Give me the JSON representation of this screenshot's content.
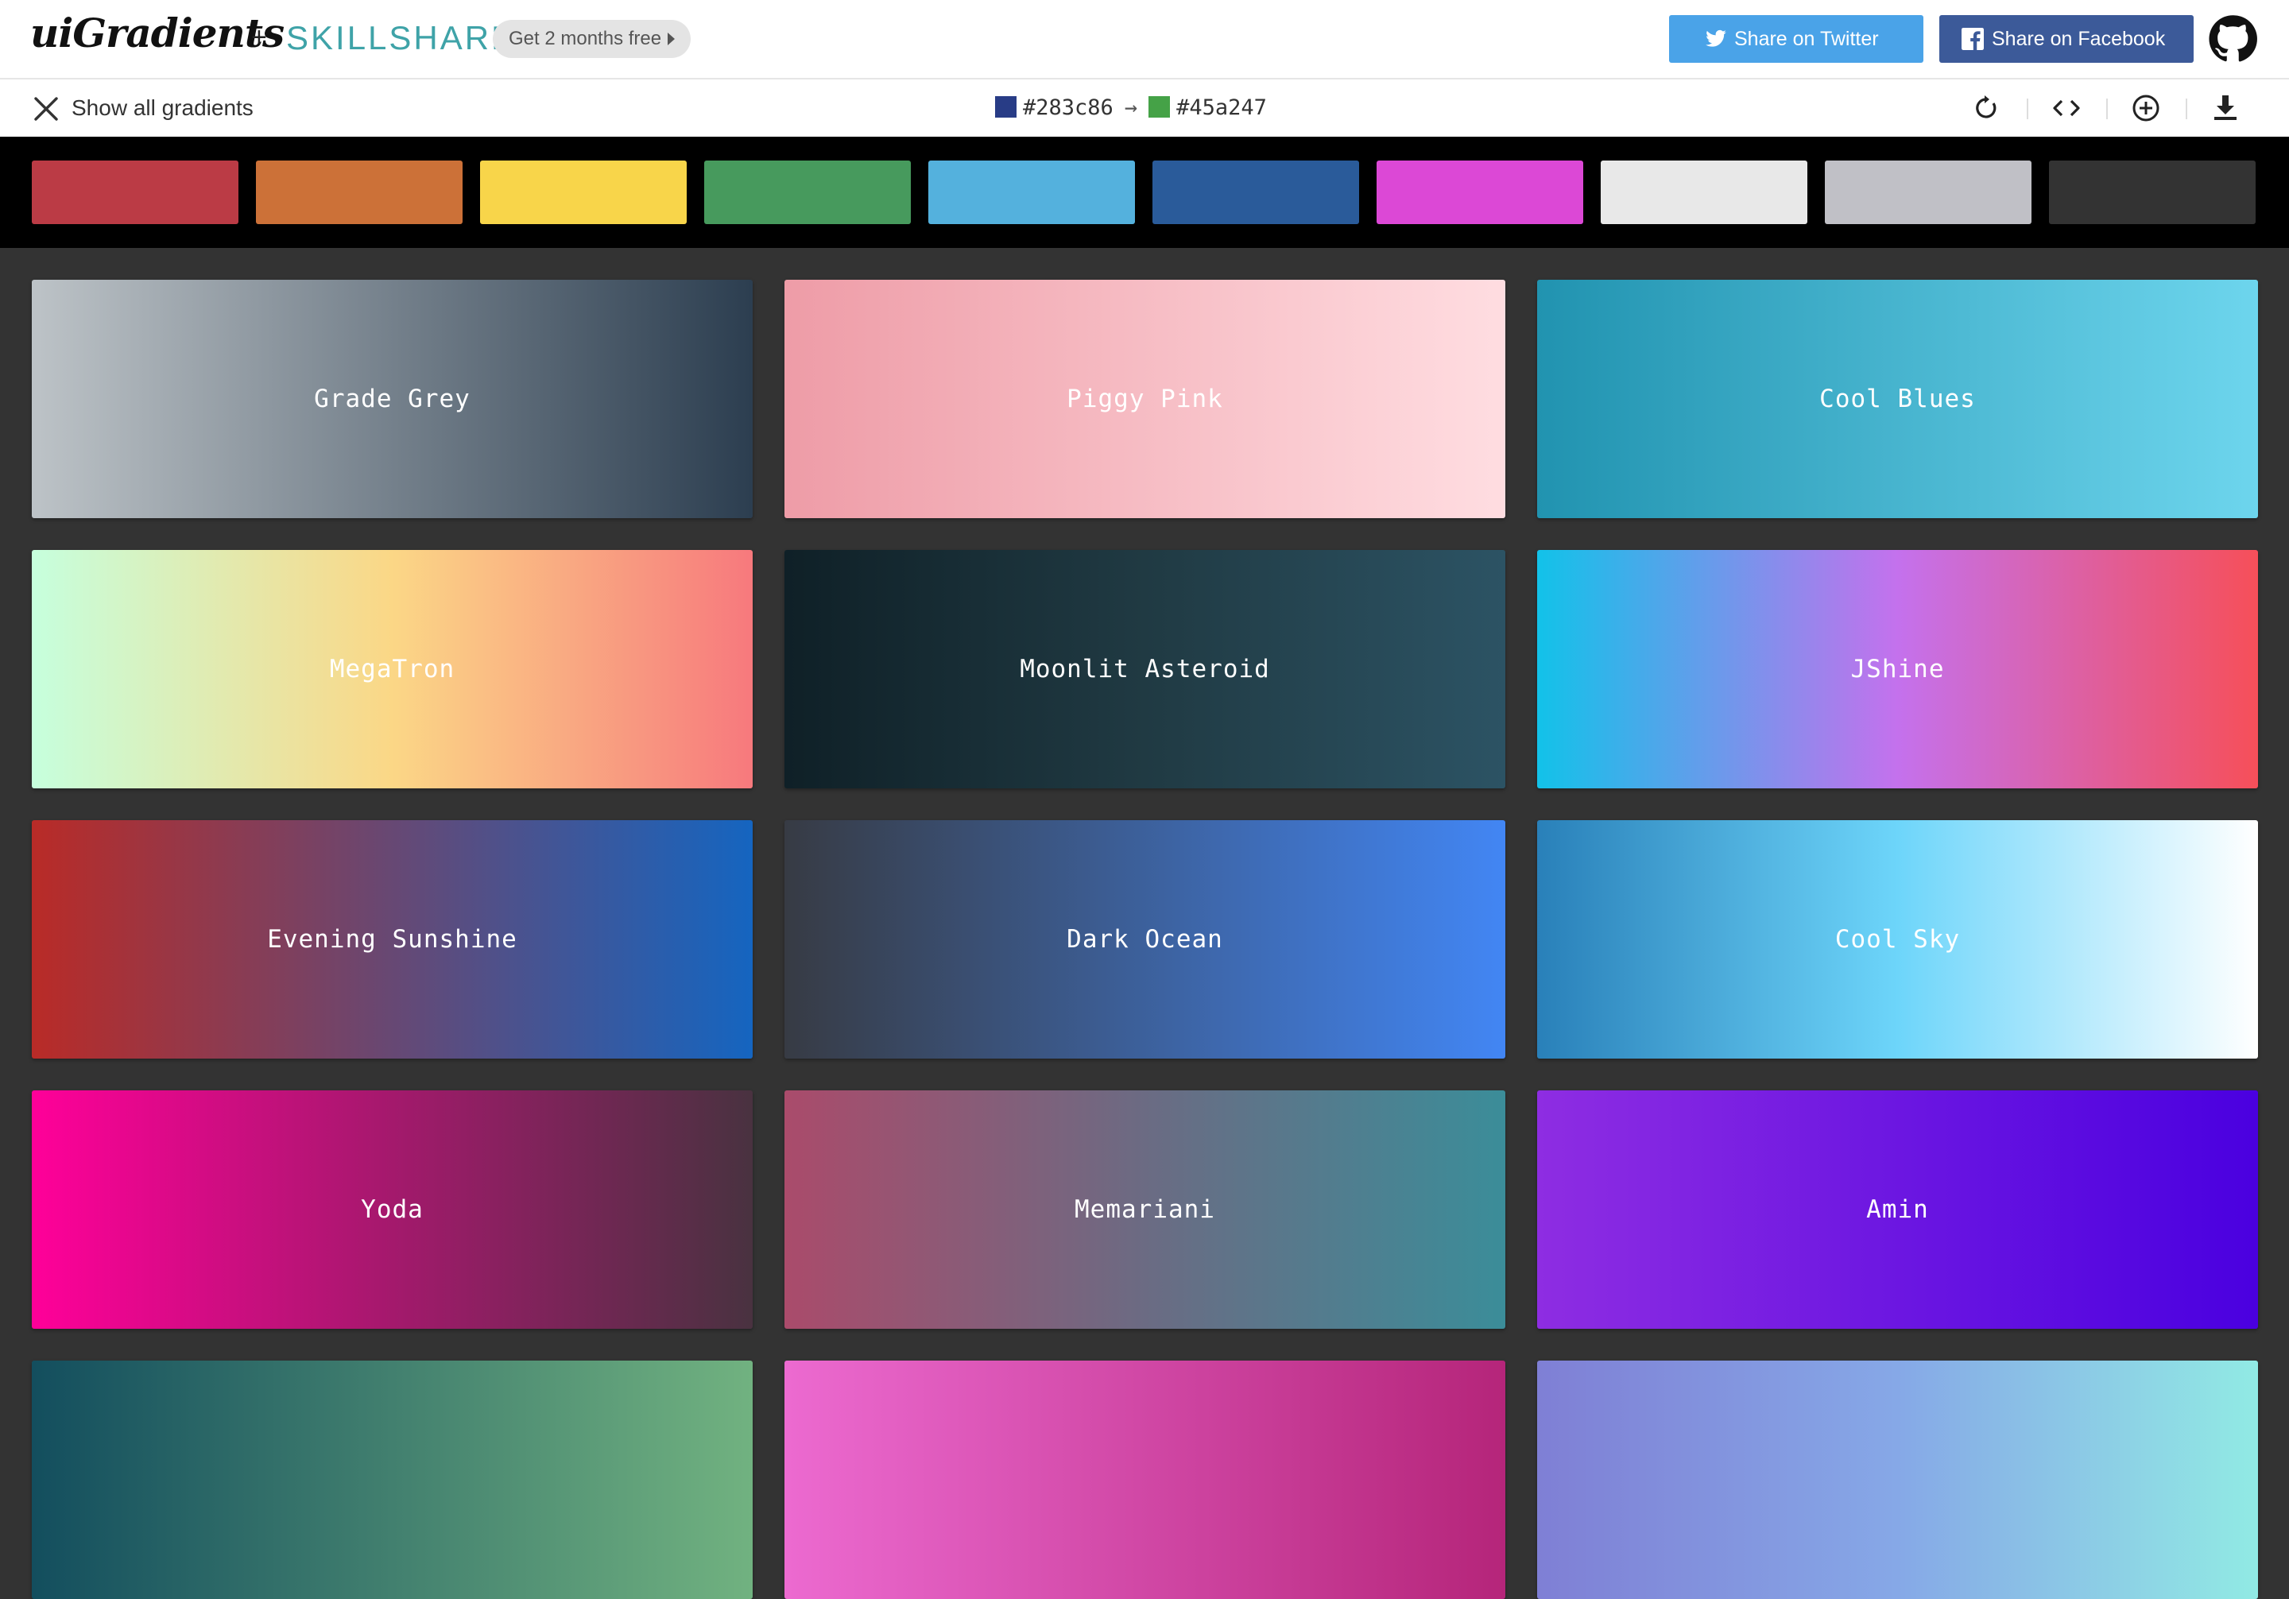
{
  "header": {
    "logo": "uiGradients",
    "plus": "+",
    "partner": "SKILLSHARE",
    "promo": "Get 2 months free",
    "share_twitter": "Share on Twitter",
    "share_facebook": "Share on Facebook"
  },
  "toolbar": {
    "show_all": "Show all gradients",
    "from_color": "#283c86",
    "to_color": "#45a247",
    "arrow": "→"
  },
  "filters": [
    {
      "color": "#bb3b45"
    },
    {
      "color": "#cc7138"
    },
    {
      "color": "#f8d54a"
    },
    {
      "color": "#479a5d"
    },
    {
      "color": "#54b1dd"
    },
    {
      "color": "#2a5b9a"
    },
    {
      "color": "#dc48d6"
    },
    {
      "color": "#e8e8e8"
    },
    {
      "color": "#c0c0c6"
    },
    {
      "color": "#333333"
    }
  ],
  "gradients": [
    {
      "name": "Grade Grey",
      "from": "#bdc3c7",
      "to": "#2c3e50"
    },
    {
      "name": "Piggy Pink",
      "from": "#ee9ca7",
      "to": "#ffdde1"
    },
    {
      "name": "Cool Blues",
      "from": "#2193b0",
      "to": "#6dd5ed"
    },
    {
      "name": "MegaTron",
      "from": "#c6ffdd",
      "via": "#fbd786",
      "to": "#f7797d"
    },
    {
      "name": "Moonlit Asteroid",
      "from": "#0f2027",
      "via": "#203a43",
      "to": "#2c5364"
    },
    {
      "name": "JShine",
      "from": "#12c2e9",
      "via": "#c471ed",
      "to": "#f64f59"
    },
    {
      "name": "Evening Sunshine",
      "from": "#b92b27",
      "to": "#1565c0"
    },
    {
      "name": "Dark Ocean",
      "from": "#373b44",
      "to": "#4286f4"
    },
    {
      "name": "Cool Sky",
      "from": "#2980b9",
      "via": "#6dd5fa",
      "to": "#ffffff"
    },
    {
      "name": "Yoda",
      "from": "#ff0099",
      "to": "#493240"
    },
    {
      "name": "Memariani",
      "from": "#aa4b6b",
      "via": "#6b6b83",
      "to": "#3b8d99"
    },
    {
      "name": "Amin",
      "from": "#8e2de2",
      "to": "#4a00e0"
    },
    {
      "name": "",
      "from": "#134e5e",
      "to": "#71b280"
    },
    {
      "name": "",
      "from": "#ec6ad0",
      "to": "#b5257a"
    },
    {
      "name": "",
      "from": "#7f7fd5",
      "via": "#86a8e7",
      "to": "#91eae4"
    }
  ]
}
